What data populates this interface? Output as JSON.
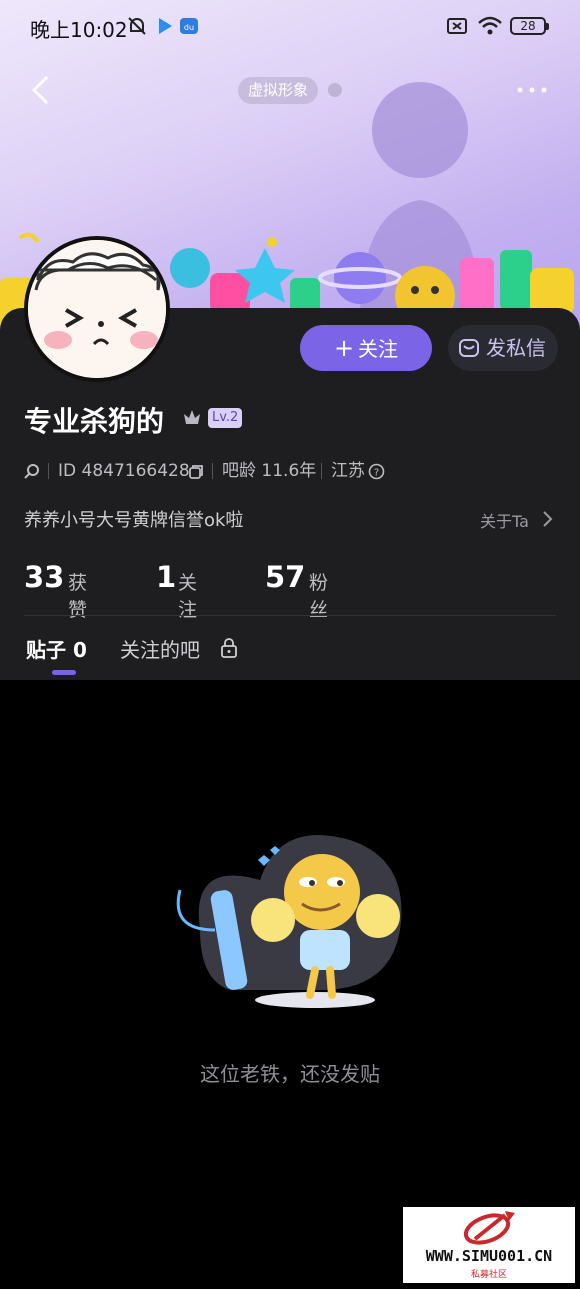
{
  "status_bar": {
    "time": "晚上10:02",
    "battery": "28"
  },
  "header": {
    "avatar_pill": "虚拟形象"
  },
  "profile": {
    "username": "专业杀狗的",
    "level": "Lv.2",
    "user_id": "ID 4847166428",
    "forum_age": "吧龄 11.6年",
    "location": "江苏",
    "bio": "养养小号大号黄牌信誉ok啦",
    "about_label": "关于Ta"
  },
  "actions": {
    "follow_label": "关注",
    "message_label": "发私信"
  },
  "stats": [
    {
      "value": "33",
      "label": "获赞"
    },
    {
      "value": "1",
      "label": "关注"
    },
    {
      "value": "57",
      "label": "粉丝"
    }
  ],
  "tabs": [
    {
      "label": "贴子 0"
    },
    {
      "label": "关注的吧"
    }
  ],
  "empty_state": {
    "message": "这位老铁，还没发贴"
  },
  "watermark": {
    "text": "WWW.SIMU001.CN",
    "sub": "私募社区"
  },
  "colors": {
    "accent": "#7b64e6",
    "panel": "#1e1e21"
  }
}
